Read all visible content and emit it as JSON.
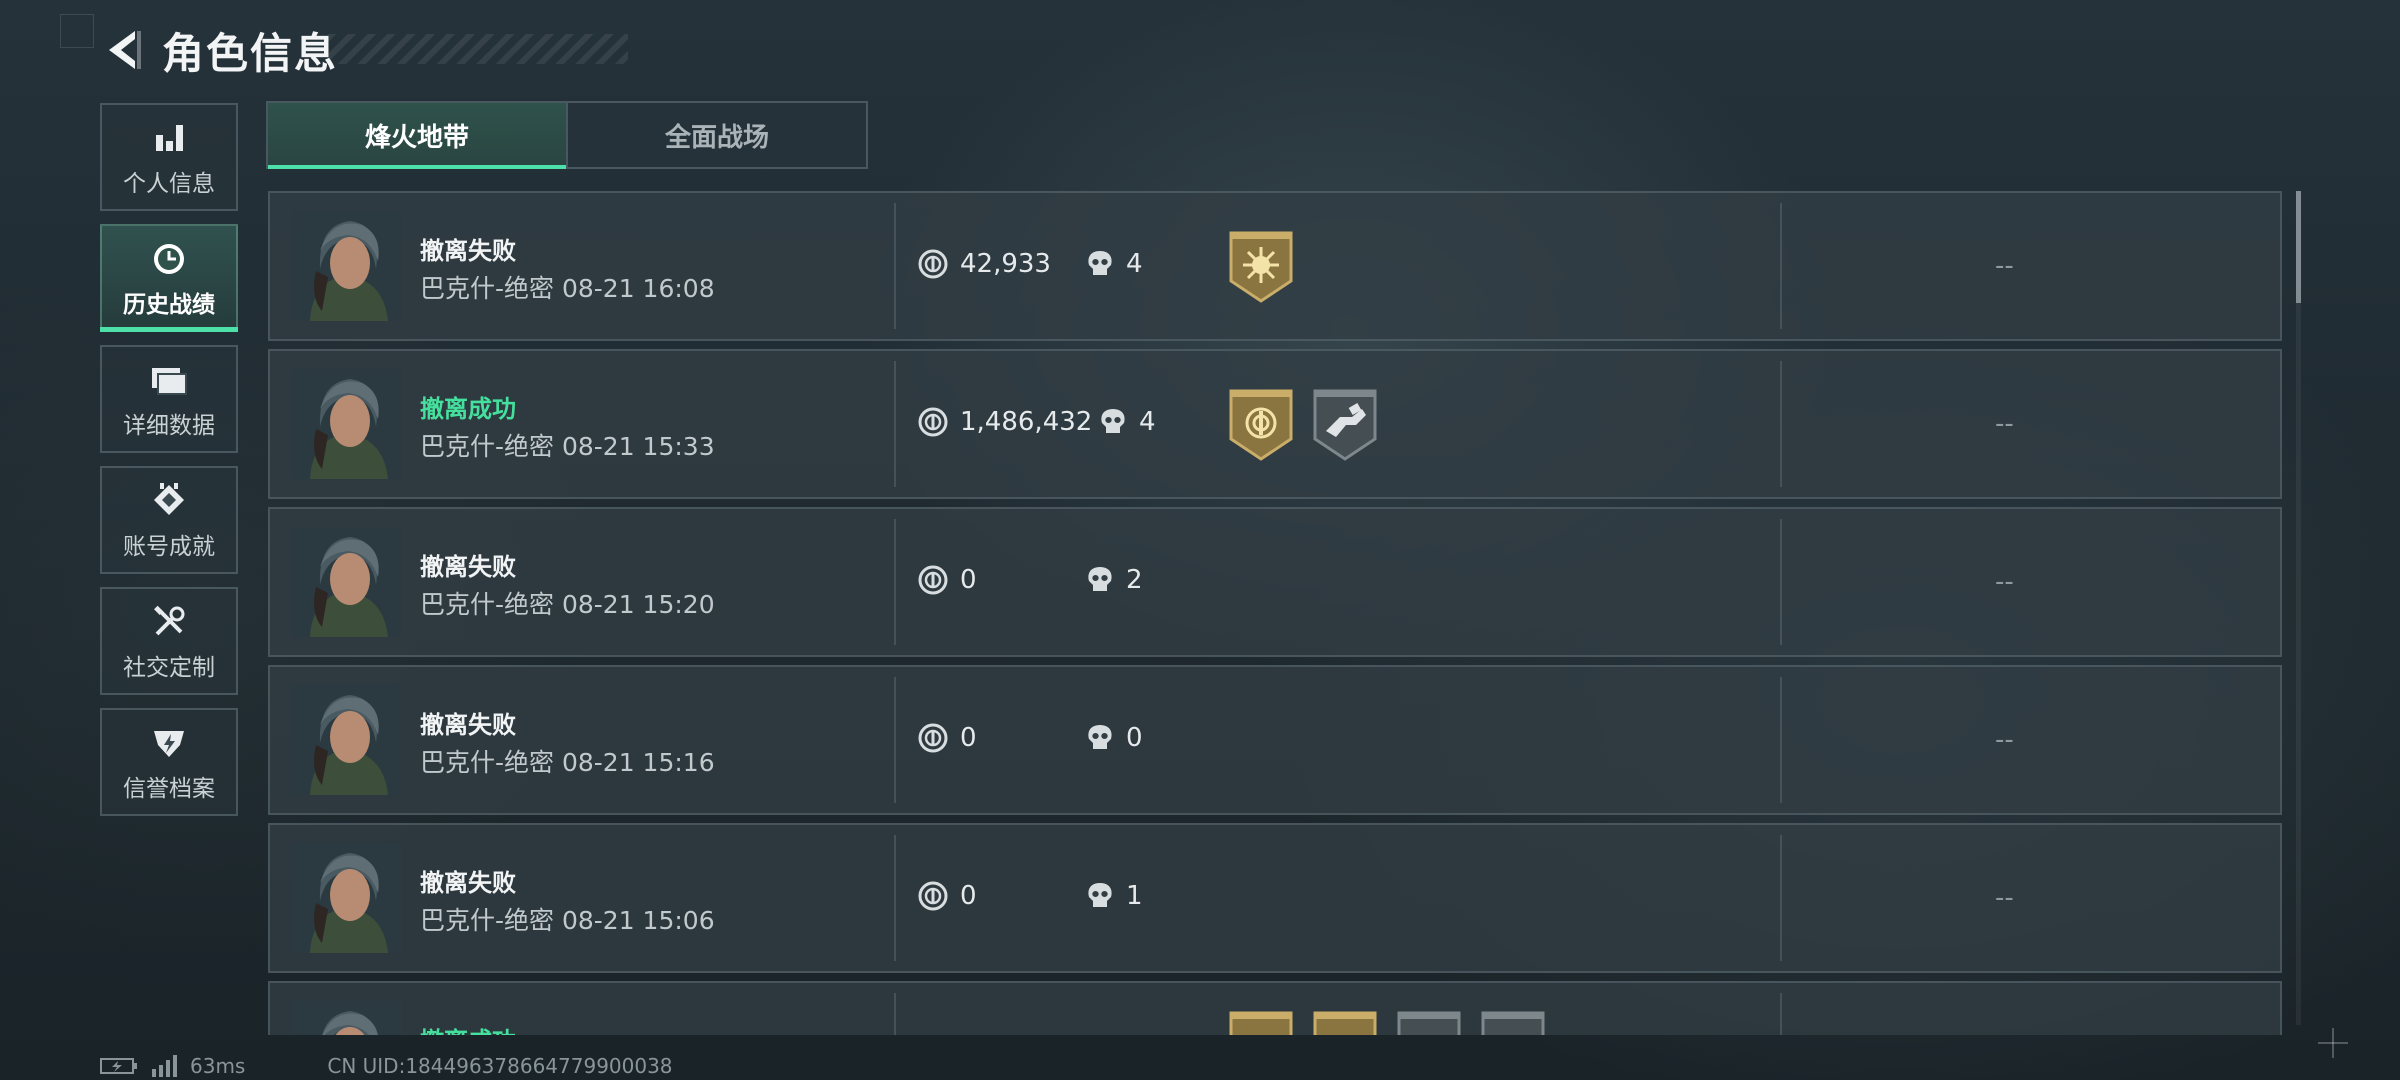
{
  "header": {
    "title": "角色信息",
    "back_icon": "back-arrow-icon"
  },
  "sidebar": {
    "items": [
      {
        "label": "个人信息",
        "icon": "bar-chart-icon",
        "active": false
      },
      {
        "label": "历史战绩",
        "icon": "clock-icon",
        "active": true
      },
      {
        "label": "详细数据",
        "icon": "folder-icon",
        "active": false
      },
      {
        "label": "账号成就",
        "icon": "achievement-icon",
        "active": false
      },
      {
        "label": "社交定制",
        "icon": "tools-icon",
        "active": false
      },
      {
        "label": "信誉档案",
        "icon": "credit-shield-icon",
        "active": false
      }
    ]
  },
  "tabs": [
    {
      "label": "烽火地带",
      "active": true
    },
    {
      "label": "全面战场",
      "active": false
    }
  ],
  "records": [
    {
      "status": "撤离失败",
      "success": false,
      "meta": "巴克什-绝密 08-21 16:08",
      "money": "42,933",
      "kills": "4",
      "badges": [
        "gold-sun-badge"
      ],
      "right": "--"
    },
    {
      "status": "撤离成功",
      "success": true,
      "meta": "巴克什-绝密 08-21 15:33",
      "money": "1,486,432",
      "kills": "4",
      "badges": [
        "gold-coin-badge",
        "gray-hand-badge"
      ],
      "right": "--"
    },
    {
      "status": "撤离失败",
      "success": false,
      "meta": "巴克什-绝密 08-21 15:20",
      "money": "0",
      "kills": "2",
      "badges": [],
      "right": "--"
    },
    {
      "status": "撤离失败",
      "success": false,
      "meta": "巴克什-绝密 08-21 15:16",
      "money": "0",
      "kills": "0",
      "badges": [],
      "right": "--"
    },
    {
      "status": "撤离失败",
      "success": false,
      "meta": "巴克什-绝密 08-21 15:06",
      "money": "0",
      "kills": "1",
      "badges": [],
      "right": "--"
    },
    {
      "status": "撤离成功",
      "success": true,
      "meta": "",
      "money": "",
      "kills": "",
      "badges": [
        "gold-badge",
        "gold-badge",
        "gray-badge",
        "gray-badge"
      ],
      "right": "--"
    }
  ],
  "footer": {
    "ping": "63ms",
    "uid": "CN UID:184496378664779900038"
  },
  "colors": {
    "accent": "#4de0a8",
    "success": "#45e09d",
    "gold": "#b89a52"
  }
}
